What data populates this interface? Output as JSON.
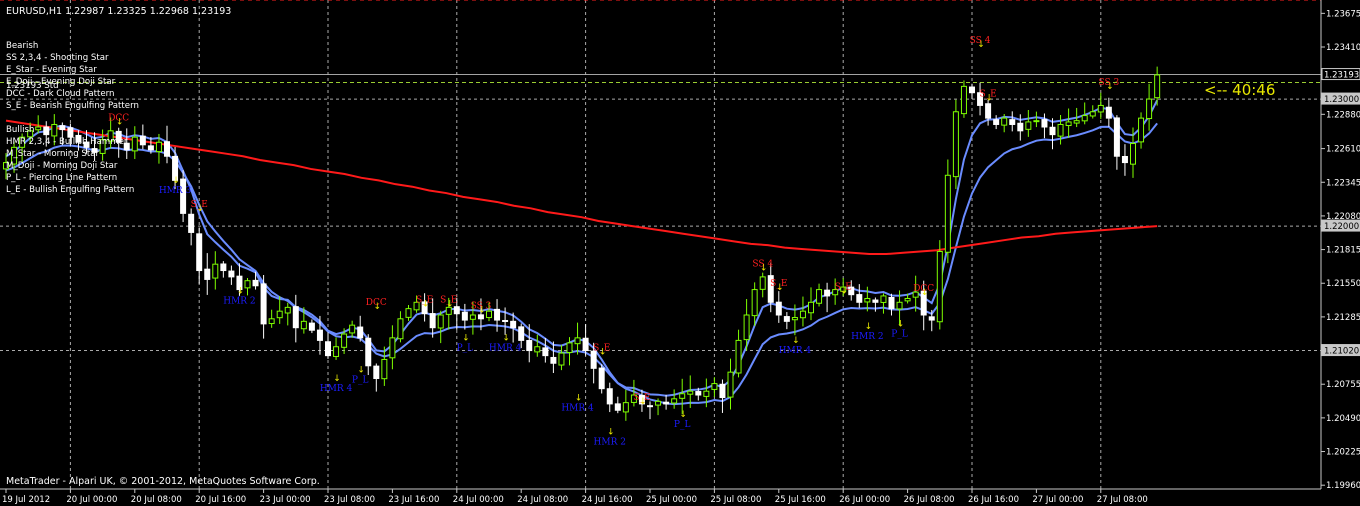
{
  "header": {
    "symbol_line": "EURUSD,H1  1.22987 1.23325 1.22968 1.23193"
  },
  "legend": {
    "bearish_title": "Bearish",
    "bearish_items": [
      "SS 2,3,4 - Shooting Star",
      "E_Star   - Evening Star",
      "E_Doji   - Evening Doji Star",
      "DCC      - Dark Cloud Pattern",
      "S_E      - Bearish Engulfing Pattern"
    ],
    "overlap_text": "1.23193 Std",
    "bullish_title": "Bullish",
    "bullish_items": [
      "HMR 2,3,4 - Bullish Hammer",
      "M_Star    - Morning Star",
      "M_Doji    - Morning Doji Star",
      "P_L       - Piercing Line Pattern",
      "L_E       - Bullish Engulfing Pattern"
    ]
  },
  "countdown": "<-- 40:46",
  "footer": "MetaTrader - Alpari UK, © 2001-2012, MetaQuotes Software Corp.",
  "colors": {
    "background": "#000000",
    "bull": "#7fff00",
    "bear": "#ffffff",
    "ma_fast": "#6a8cff",
    "ma_slow": "#ff1a1a",
    "bear_label": "#ff2020",
    "bull_label": "#1c1cff",
    "grid": "#c8c8c8",
    "countdown": "#e8e800"
  },
  "chart_data": {
    "type": "candlestick",
    "symbol": "EURUSD",
    "timeframe": "H1",
    "y_ticks": [
      "1.23675",
      "1.23410",
      "1.22880",
      "1.22610",
      "1.22345",
      "1.22080",
      "1.21815",
      "1.21550",
      "1.21285",
      "1.20755",
      "1.20490",
      "1.20225",
      "1.19960"
    ],
    "y_boxed_labels": [
      "1.23193",
      "1.23000",
      "1.22000",
      "1.21020"
    ],
    "ylim": [
      1.1993,
      1.2378
    ],
    "current_price": 1.23193,
    "red_dashed_level": 1.2378,
    "green_dashed_level": 1.2313,
    "x_ticks": [
      {
        "label": "19 Jul 2012",
        "i": 0
      },
      {
        "label": "20 Jul 00:00",
        "i": 8
      },
      {
        "label": "20 Jul 08:00",
        "i": 16
      },
      {
        "label": "20 Jul 16:00",
        "i": 24
      },
      {
        "label": "23 Jul 00:00",
        "i": 32
      },
      {
        "label": "23 Jul 08:00",
        "i": 40
      },
      {
        "label": "23 Jul 16:00",
        "i": 48
      },
      {
        "label": "24 Jul 00:00",
        "i": 56
      },
      {
        "label": "24 Jul 08:00",
        "i": 64
      },
      {
        "label": "24 Jul 16:00",
        "i": 72
      },
      {
        "label": "25 Jul 00:00",
        "i": 80
      },
      {
        "label": "25 Jul 08:00",
        "i": 88
      },
      {
        "label": "25 Jul 16:00",
        "i": 96
      },
      {
        "label": "26 Jul 00:00",
        "i": 104
      },
      {
        "label": "26 Jul 08:00",
        "i": 112
      },
      {
        "label": "26 Jul 16:00",
        "i": 120
      },
      {
        "label": "27 Jul 00:00",
        "i": 128
      },
      {
        "label": "27 Jul 08:00",
        "i": 136
      }
    ],
    "vgrid_indices": [
      8,
      24,
      40,
      56,
      72,
      88,
      104,
      120,
      136
    ],
    "hgrid_levels": [
      1.23,
      1.22,
      1.2102
    ],
    "closes": [
      1.225,
      1.2262,
      1.227,
      1.2275,
      1.2278,
      1.2272,
      1.228,
      1.2276,
      1.227,
      1.2266,
      1.2262,
      1.2258,
      1.2268,
      1.2275,
      1.2266,
      1.226,
      1.227,
      1.2264,
      1.226,
      1.2266,
      1.2255,
      1.2236,
      1.221,
      1.2195,
      1.2165,
      1.2158,
      1.217,
      1.2165,
      1.216,
      1.215,
      1.2157,
      1.2153,
      1.2123,
      1.2127,
      1.2133,
      1.2136,
      1.212,
      1.2125,
      1.2118,
      1.211,
      1.2098,
      1.2105,
      1.2115,
      1.2122,
      1.2112,
      1.209,
      1.208,
      1.2095,
      1.2112,
      1.2127,
      1.2135,
      1.214,
      1.2131,
      1.212,
      1.213,
      1.2136,
      1.2131,
      1.2126,
      1.213,
      1.2127,
      1.2133,
      1.2126,
      1.2125,
      1.212,
      1.211,
      1.2102,
      1.2105,
      1.2098,
      1.2092,
      1.21,
      1.2108,
      1.2112,
      1.2102,
      1.2088,
      1.2072,
      1.206,
      1.2055,
      1.2061,
      1.2067,
      1.206,
      1.2058,
      1.2062,
      1.206,
      1.2064,
      1.2068,
      1.207,
      1.2067,
      1.207,
      1.2076,
      1.2065,
      1.2085,
      1.211,
      1.213,
      1.215,
      1.216,
      1.214,
      1.213,
      1.2125,
      1.2128,
      1.2133,
      1.214,
      1.215,
      1.2145,
      1.215,
      1.2152,
      1.2146,
      1.214,
      1.2143,
      1.214,
      1.2145,
      1.2135,
      1.214,
      1.2143,
      1.2148,
      1.213,
      1.2126,
      1.218,
      1.224,
      1.229,
      1.231,
      1.2305,
      1.2295,
      1.2285,
      1.228,
      1.2285,
      1.228,
      1.2275,
      1.2282,
      1.2283,
      1.2278,
      1.2272,
      1.228,
      1.2282,
      1.2283,
      1.2287,
      1.229,
      1.2295,
      1.2285,
      1.2255,
      1.225,
      1.2265,
      1.2285,
      1.23,
      1.2319
    ],
    "ma_slow": [
      1.2283,
      1.2281,
      1.2279,
      1.2277,
      1.2275,
      1.2273,
      1.2271,
      1.2269,
      1.2267,
      1.2265,
      1.2263,
      1.2261,
      1.2259,
      1.2257,
      1.2255,
      1.2252,
      1.225,
      1.2248,
      1.2245,
      1.2243,
      1.2241,
      1.2238,
      1.2236,
      1.2233,
      1.2231,
      1.2228,
      1.2226,
      1.2223,
      1.2221,
      1.2219,
      1.2216,
      1.2214,
      1.2211,
      1.2209,
      1.2207,
      1.2204,
      1.2202,
      1.22,
      1.2198,
      1.2196,
      1.2194,
      1.2192,
      1.219,
      1.2188,
      1.2186,
      1.2185,
      1.2183,
      1.2182,
      1.2181,
      1.218,
      1.2179,
      1.2178,
      1.2178,
      1.2179,
      1.218,
      1.2181,
      1.2183,
      1.2185,
      1.2187,
      1.2189,
      1.2191,
      1.2192,
      1.2194,
      1.2195,
      1.2196,
      1.2197,
      1.2198,
      1.2199,
      1.22
    ],
    "ma_slow_start": 77,
    "pattern_labels": [
      {
        "text": "DCC",
        "i": 14,
        "price": 1.2283,
        "kind": "bear"
      },
      {
        "text": "S_E",
        "i": 24,
        "price": 1.2215,
        "kind": "bear"
      },
      {
        "text": "HMR 3",
        "i": 21,
        "price": 1.2226,
        "kind": "bull"
      },
      {
        "text": "HMR 2",
        "i": 29,
        "price": 1.2139,
        "kind": "bull"
      },
      {
        "text": "DCC",
        "i": 46,
        "price": 1.2138,
        "kind": "bear"
      },
      {
        "text": "HMR 4",
        "i": 41,
        "price": 1.207,
        "kind": "bull"
      },
      {
        "text": "P_L",
        "i": 44,
        "price": 1.2077,
        "kind": "bull"
      },
      {
        "text": "S_E",
        "i": 52,
        "price": 1.214,
        "kind": "bear"
      },
      {
        "text": "S_E",
        "i": 55,
        "price": 1.214,
        "kind": "bear"
      },
      {
        "text": "SS 3",
        "i": 59,
        "price": 1.2135,
        "kind": "bear"
      },
      {
        "text": "P_L",
        "i": 57,
        "price": 1.2102,
        "kind": "bull"
      },
      {
        "text": "HMR 4",
        "i": 62,
        "price": 1.2102,
        "kind": "bull"
      },
      {
        "text": "S_E",
        "i": 74,
        "price": 1.2102,
        "kind": "bear"
      },
      {
        "text": "HMR 4",
        "i": 71,
        "price": 1.2055,
        "kind": "bull"
      },
      {
        "text": "HMR 2",
        "i": 75,
        "price": 1.2028,
        "kind": "bull"
      },
      {
        "text": "S_E",
        "i": 79,
        "price": 1.2063,
        "kind": "bear"
      },
      {
        "text": "P_L",
        "i": 84,
        "price": 1.2042,
        "kind": "bull"
      },
      {
        "text": "SS 4",
        "i": 94,
        "price": 1.2168,
        "kind": "bear"
      },
      {
        "text": "S_E",
        "i": 96,
        "price": 1.2153,
        "kind": "bear"
      },
      {
        "text": "HMR 4",
        "i": 98,
        "price": 1.21,
        "kind": "bull"
      },
      {
        "text": "S_E",
        "i": 104,
        "price": 1.215,
        "kind": "bear"
      },
      {
        "text": "HMR 2",
        "i": 107,
        "price": 1.2111,
        "kind": "bull"
      },
      {
        "text": "P_L",
        "i": 111,
        "price": 1.2113,
        "kind": "bull"
      },
      {
        "text": "DCC",
        "i": 114,
        "price": 1.2149,
        "kind": "bear"
      },
      {
        "text": "SS 4",
        "i": 121,
        "price": 1.2344,
        "kind": "bear"
      },
      {
        "text": "S_E",
        "i": 122,
        "price": 1.2302,
        "kind": "bear"
      },
      {
        "text": "SS 3",
        "i": 137,
        "price": 1.2311,
        "kind": "bear"
      }
    ]
  }
}
